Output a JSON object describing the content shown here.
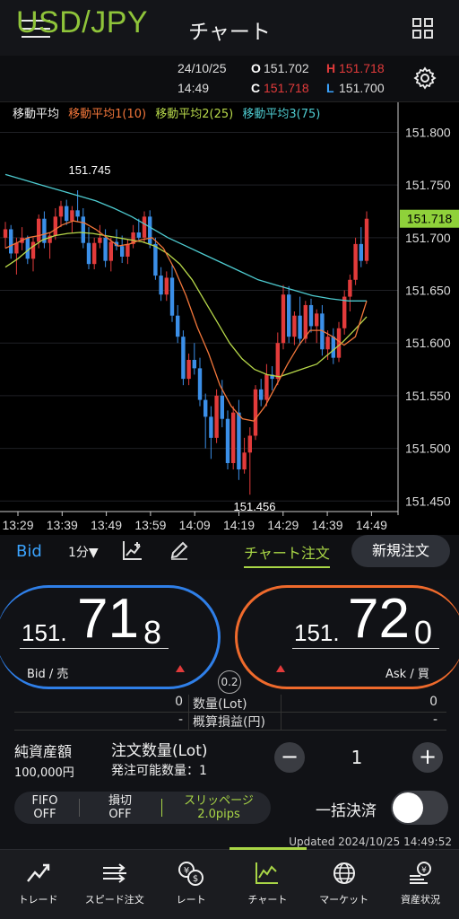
{
  "header": {
    "title": "チャート",
    "menu_icon": "hamburger-menu-icon",
    "layout_icon": "grid-layout-icon"
  },
  "quote": {
    "pair": "USD/JPY",
    "date": "24/10/25",
    "time": "14:49",
    "open_label": "O",
    "open": "151.702",
    "high_label": "H",
    "high": "151.718",
    "close_label": "C",
    "close": "151.718",
    "low_label": "L",
    "low": "151.700",
    "settings_icon": "gear-icon"
  },
  "indicators": {
    "title": "移動平均",
    "ma1": "移動平均1(10)",
    "ma2": "移動平均2(25)",
    "ma3": "移動平均3(75)",
    "colors": {
      "ma1": "#f2763a",
      "ma2": "#b7d84a",
      "ma3": "#4ecbd0"
    }
  },
  "chart_data": {
    "type": "candlestick",
    "y_ticks": [
      "151.800",
      "151.750",
      "151.700",
      "151.650",
      "151.600",
      "151.550",
      "151.500",
      "151.450"
    ],
    "ylim": [
      151.44,
      151.82
    ],
    "x_ticks": [
      "13:29",
      "13:39",
      "13:49",
      "13:59",
      "14:09",
      "14:19",
      "14:29",
      "14:39",
      "14:49"
    ],
    "current_price": "151.718",
    "high_annotation": "151.745",
    "low_annotation": "151.456",
    "candles": [
      [
        151.7,
        151.715,
        151.69,
        151.708
      ],
      [
        151.708,
        151.712,
        151.68,
        151.685
      ],
      [
        151.685,
        151.7,
        151.665,
        151.695
      ],
      [
        151.695,
        151.71,
        151.688,
        151.7
      ],
      [
        151.7,
        151.702,
        151.675,
        151.68
      ],
      [
        151.68,
        151.7,
        151.668,
        151.696
      ],
      [
        151.696,
        151.722,
        151.69,
        151.718
      ],
      [
        151.718,
        151.725,
        151.69,
        151.695
      ],
      [
        151.695,
        151.705,
        151.68,
        151.702
      ],
      [
        151.702,
        151.728,
        151.698,
        151.72
      ],
      [
        151.72,
        151.735,
        151.71,
        151.73
      ],
      [
        151.73,
        151.736,
        151.712,
        151.716
      ],
      [
        151.716,
        151.73,
        151.705,
        151.726
      ],
      [
        151.726,
        151.745,
        151.715,
        151.72
      ],
      [
        151.72,
        151.728,
        151.69,
        151.695
      ],
      [
        151.695,
        151.71,
        151.67,
        151.675
      ],
      [
        151.675,
        151.7,
        151.67,
        151.695
      ],
      [
        151.695,
        151.712,
        151.69,
        151.7
      ],
      [
        151.7,
        151.708,
        151.672,
        151.678
      ],
      [
        151.678,
        151.7,
        151.668,
        151.696
      ],
      [
        151.696,
        151.708,
        151.688,
        151.692
      ],
      [
        151.692,
        151.702,
        151.676,
        151.682
      ],
      [
        151.682,
        151.698,
        151.675,
        151.694
      ],
      [
        151.694,
        151.712,
        151.69,
        151.705
      ],
      [
        151.705,
        151.718,
        151.698,
        151.7
      ],
      [
        151.7,
        151.725,
        151.695,
        151.72
      ],
      [
        151.72,
        151.726,
        151.69,
        151.694
      ],
      [
        151.694,
        151.7,
        151.66,
        151.664
      ],
      [
        151.664,
        151.672,
        151.64,
        151.646
      ],
      [
        151.646,
        151.668,
        151.64,
        151.662
      ],
      [
        151.662,
        151.674,
        151.62,
        151.626
      ],
      [
        151.626,
        151.636,
        151.6,
        151.606
      ],
      [
        151.606,
        151.612,
        151.56,
        151.566
      ],
      [
        151.566,
        151.59,
        151.56,
        151.584
      ],
      [
        151.584,
        151.6,
        151.57,
        151.576
      ],
      [
        151.576,
        151.586,
        151.54,
        151.546
      ],
      [
        151.546,
        151.552,
        151.5,
        151.53
      ],
      [
        151.53,
        151.54,
        151.49,
        151.51
      ],
      [
        151.51,
        151.556,
        151.505,
        151.55
      ],
      [
        151.55,
        151.565,
        151.52,
        151.528
      ],
      [
        151.528,
        151.536,
        151.48,
        151.486
      ],
      [
        151.486,
        151.54,
        151.48,
        151.534
      ],
      [
        151.534,
        151.546,
        151.47,
        151.48
      ],
      [
        151.48,
        151.51,
        151.476,
        151.496
      ],
      [
        151.496,
        151.52,
        151.456,
        151.512
      ],
      [
        151.512,
        151.56,
        151.508,
        151.556
      ],
      [
        151.556,
        151.566,
        151.54,
        151.546
      ],
      [
        151.546,
        151.58,
        151.54,
        151.57
      ],
      [
        151.57,
        151.578,
        151.555,
        151.566
      ],
      [
        151.566,
        151.61,
        151.56,
        151.6
      ],
      [
        151.6,
        151.655,
        151.594,
        151.646
      ],
      [
        151.646,
        151.654,
        151.6,
        151.606
      ],
      [
        151.606,
        151.63,
        151.598,
        151.626
      ],
      [
        151.626,
        151.644,
        151.598,
        151.604
      ],
      [
        151.604,
        151.64,
        151.6,
        151.636
      ],
      [
        151.636,
        151.642,
        151.61,
        151.616
      ],
      [
        151.616,
        151.632,
        151.6,
        151.628
      ],
      [
        151.628,
        151.636,
        151.588,
        151.594
      ],
      [
        151.594,
        151.612,
        151.584,
        151.606
      ],
      [
        151.606,
        151.614,
        151.58,
        151.586
      ],
      [
        151.586,
        151.62,
        151.582,
        151.614
      ],
      [
        151.614,
        151.65,
        151.608,
        151.644
      ],
      [
        151.644,
        151.665,
        151.63,
        151.66
      ],
      [
        151.66,
        151.7,
        151.655,
        151.694
      ],
      [
        151.694,
        151.71,
        151.672,
        151.678
      ],
      [
        151.678,
        151.725,
        151.675,
        151.718
      ]
    ],
    "ma1": [
      151.69,
      151.695,
      151.7,
      151.702,
      151.705,
      151.712,
      151.716,
      151.714,
      151.708,
      151.7,
      151.692,
      151.694,
      151.698,
      151.7,
      151.69,
      151.67,
      151.645,
      151.615,
      151.59,
      151.56,
      151.54,
      151.528,
      151.526,
      151.54,
      151.56,
      151.58,
      151.598,
      151.612,
      151.612,
      151.606,
      151.598,
      151.606,
      151.64
    ],
    "ma2": [
      151.672,
      151.68,
      151.69,
      151.698,
      151.702,
      151.704,
      151.705,
      151.704,
      151.702,
      151.7,
      151.698,
      151.696,
      151.692,
      151.685,
      151.675,
      151.66,
      151.64,
      151.62,
      151.6,
      151.585,
      151.575,
      151.57,
      151.568,
      151.572,
      151.576,
      151.58,
      151.59,
      151.6,
      151.612,
      151.625
    ],
    "ma3": [
      151.76,
      151.755,
      151.75,
      151.745,
      151.74,
      151.735,
      151.728,
      151.72,
      151.71,
      151.7,
      151.692,
      151.684,
      151.676,
      151.668,
      151.66,
      151.655,
      151.65,
      151.645,
      151.642,
      151.64,
      151.64
    ]
  },
  "toolbar": {
    "bid": "Bid",
    "timeframe": "1分▼",
    "chart_order": "チャート注文",
    "new_order": "新規注文",
    "indicator_icon": "chart-indicator-icon",
    "draw_icon": "pencil-icon"
  },
  "bid": {
    "prefix": "151.",
    "big": "71",
    "small": "8",
    "label": "Bid / 売"
  },
  "ask": {
    "prefix": "151.",
    "big": "72",
    "small": "0",
    "label": "Ask / 買"
  },
  "spread": "0.2",
  "positions": {
    "rows": [
      {
        "left": "0",
        "label": "数量(Lot)",
        "right": "0"
      },
      {
        "left": "-",
        "label": "概算損益(円)",
        "right": "-"
      }
    ]
  },
  "account": {
    "equity_label": "純資産額",
    "equity_value": "100,000円",
    "order_qty_label": "注文数量(Lot)",
    "available_label": "発注可能数量：1",
    "qty_value": "1",
    "minus": "−",
    "plus": "+"
  },
  "options": {
    "fifo": "FIFO",
    "fifo_state": "OFF",
    "stoploss": "損切",
    "stoploss_state": "OFF",
    "slippage": "スリッページ",
    "slippage_value": "2.0pips",
    "bulk_settle": "一括決済"
  },
  "updated": "Updated  2024/10/25 14:49:52",
  "nav": [
    {
      "label": "トレード",
      "icon": "trade-icon"
    },
    {
      "label": "スピード注文",
      "icon": "speed-order-icon"
    },
    {
      "label": "レート",
      "icon": "rate-icon"
    },
    {
      "label": "チャート",
      "icon": "chart-icon"
    },
    {
      "label": "マーケット",
      "icon": "globe-icon"
    },
    {
      "label": "資産状況",
      "icon": "assets-icon"
    }
  ]
}
